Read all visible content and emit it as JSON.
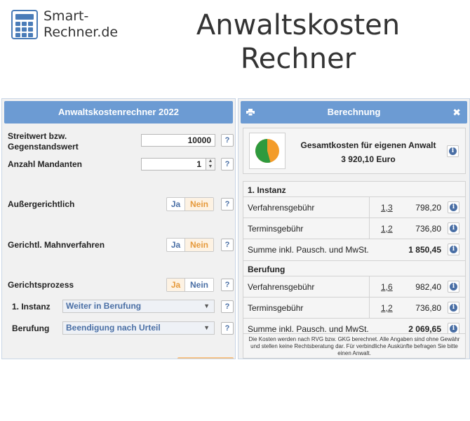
{
  "brand": {
    "name": "Smart-\nRechner.de"
  },
  "page_title": "Anwaltskosten\nRechner",
  "colors": {
    "header_blue": "#6c9bd3",
    "orange": "#e69a3c",
    "link_blue": "#4a6fa5",
    "pie_green": "#2e9a3e",
    "pie_orange": "#f39c2a"
  },
  "left_panel": {
    "title": "Anwaltskostenrechner 2022",
    "streitwert": {
      "label": "Streitwert bzw. Gegenstandswert",
      "value": "10000",
      "help": "?"
    },
    "mandanten": {
      "label": "Anzahl Mandanten",
      "value": "1",
      "help": "?"
    },
    "aussergerichtlich": {
      "label": "Außergerichtlich",
      "ja": "Ja",
      "nein": "Nein",
      "selected": "Nein",
      "help": "?"
    },
    "mahnverfahren": {
      "label": "Gerichtl. Mahnverfahren",
      "ja": "Ja",
      "nein": "Nein",
      "selected": "Nein",
      "help": "?"
    },
    "gerichtsprozess": {
      "label": "Gerichtsprozess",
      "ja": "Ja",
      "nein": "Nein",
      "selected": "Ja",
      "help": "?"
    },
    "instanz1": {
      "label": "1. Instanz",
      "value": "Weiter in Berufung",
      "help": "?"
    },
    "berufung": {
      "label": "Berufung",
      "value": "Beendigung nach Urteil",
      "help": "?"
    }
  },
  "right_panel": {
    "title": "Berechnung",
    "icons": {
      "print": "print-icon",
      "close": "close-icon"
    },
    "close_symbol": "✖",
    "summary": {
      "title": "Gesamtkosten für eigenen Anwalt",
      "value": "3 920,10 Euro"
    },
    "instanz1": {
      "title": "1. Instanz",
      "rows": [
        {
          "name": "Verfahrensgebühr",
          "factor": "1,3",
          "amount": "798,20"
        },
        {
          "name": "Terminsgebühr",
          "factor": "1,2",
          "amount": "736,80"
        }
      ],
      "total_label": "Summe inkl. Pausch. und MwSt.",
      "total": "1 850,45"
    },
    "berufung": {
      "title": "Berufung",
      "rows": [
        {
          "name": "Verfahrensgebühr",
          "factor": "1,6",
          "amount": "982,40"
        },
        {
          "name": "Terminsgebühr",
          "factor": "1,2",
          "amount": "736,80"
        }
      ],
      "total_label": "Summe inkl. Pausch. und MwSt.",
      "total": "2 069,65"
    },
    "disclaimer": "Die Kosten werden nach RVG bzw. GKG berechnet. Alle Angaben sind ohne Gewähr und stellen keine Rechtsberatung dar. Für verbindliche Auskünfte befragen Sie bitte einen Anwalt."
  }
}
